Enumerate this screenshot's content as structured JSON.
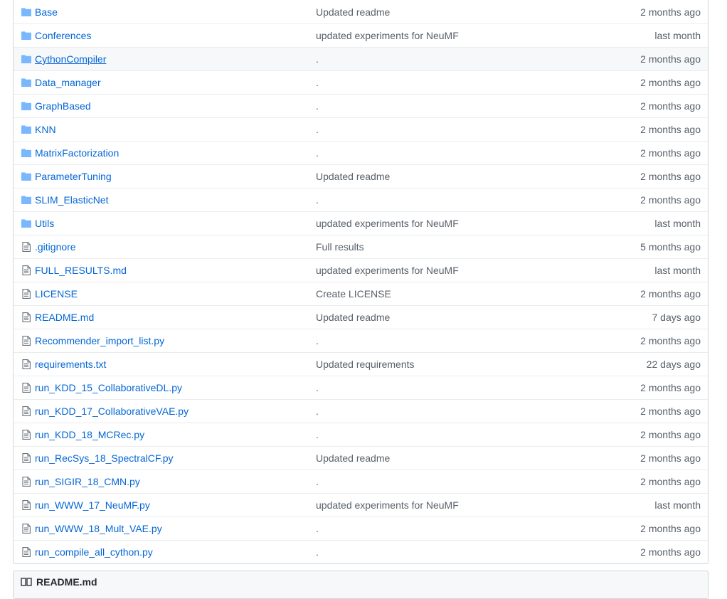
{
  "colors": {
    "link": "#0366d6",
    "muted": "#586069",
    "folder_icon": "#79b8ff",
    "file_icon": "#6a737d",
    "border": "#d1d5da"
  },
  "files": [
    {
      "type": "folder",
      "icon": "folder-icon",
      "name": "Base",
      "message": "Updated readme",
      "age": "2 months ago"
    },
    {
      "type": "folder",
      "icon": "folder-icon",
      "name": "Conferences",
      "message": "updated experiments for NeuMF",
      "age": "last month"
    },
    {
      "type": "folder",
      "icon": "folder-icon",
      "name": "CythonCompiler",
      "message": ".",
      "age": "2 months ago"
    },
    {
      "type": "folder",
      "icon": "folder-icon",
      "name": "Data_manager",
      "message": ".",
      "age": "2 months ago"
    },
    {
      "type": "folder",
      "icon": "folder-icon",
      "name": "GraphBased",
      "message": ".",
      "age": "2 months ago"
    },
    {
      "type": "folder",
      "icon": "folder-icon",
      "name": "KNN",
      "message": ".",
      "age": "2 months ago"
    },
    {
      "type": "folder",
      "icon": "folder-icon",
      "name": "MatrixFactorization",
      "message": ".",
      "age": "2 months ago"
    },
    {
      "type": "folder",
      "icon": "folder-icon",
      "name": "ParameterTuning",
      "message": "Updated readme",
      "age": "2 months ago"
    },
    {
      "type": "folder",
      "icon": "folder-icon",
      "name": "SLIM_ElasticNet",
      "message": ".",
      "age": "2 months ago"
    },
    {
      "type": "folder",
      "icon": "folder-icon",
      "name": "Utils",
      "message": "updated experiments for NeuMF",
      "age": "last month"
    },
    {
      "type": "file",
      "icon": "file-icon",
      "name": ".gitignore",
      "message": "Full results",
      "age": "5 months ago"
    },
    {
      "type": "file",
      "icon": "file-icon",
      "name": "FULL_RESULTS.md",
      "message": "updated experiments for NeuMF",
      "age": "last month"
    },
    {
      "type": "file",
      "icon": "file-icon",
      "name": "LICENSE",
      "message": "Create LICENSE",
      "age": "2 months ago"
    },
    {
      "type": "file",
      "icon": "file-icon",
      "name": "README.md",
      "message": "Updated readme",
      "age": "7 days ago"
    },
    {
      "type": "file",
      "icon": "file-icon",
      "name": "Recommender_import_list.py",
      "message": ".",
      "age": "2 months ago"
    },
    {
      "type": "file",
      "icon": "file-icon",
      "name": "requirements.txt",
      "message": "Updated requirements",
      "age": "22 days ago"
    },
    {
      "type": "file",
      "icon": "file-icon",
      "name": "run_KDD_15_CollaborativeDL.py",
      "message": ".",
      "age": "2 months ago"
    },
    {
      "type": "file",
      "icon": "file-icon",
      "name": "run_KDD_17_CollaborativeVAE.py",
      "message": ".",
      "age": "2 months ago"
    },
    {
      "type": "file",
      "icon": "file-icon",
      "name": "run_KDD_18_MCRec.py",
      "message": ".",
      "age": "2 months ago"
    },
    {
      "type": "file",
      "icon": "file-icon",
      "name": "run_RecSys_18_SpectralCF.py",
      "message": "Updated readme",
      "age": "2 months ago"
    },
    {
      "type": "file",
      "icon": "file-icon",
      "name": "run_SIGIR_18_CMN.py",
      "message": ".",
      "age": "2 months ago"
    },
    {
      "type": "file",
      "icon": "file-icon",
      "name": "run_WWW_17_NeuMF.py",
      "message": "updated experiments for NeuMF",
      "age": "last month"
    },
    {
      "type": "file",
      "icon": "file-icon",
      "name": "run_WWW_18_Mult_VAE.py",
      "message": ".",
      "age": "2 months ago"
    },
    {
      "type": "file",
      "icon": "file-icon",
      "name": "run_compile_all_cython.py",
      "message": ".",
      "age": "2 months ago"
    }
  ],
  "readme": {
    "title": "README.md",
    "icon": "book-icon"
  }
}
